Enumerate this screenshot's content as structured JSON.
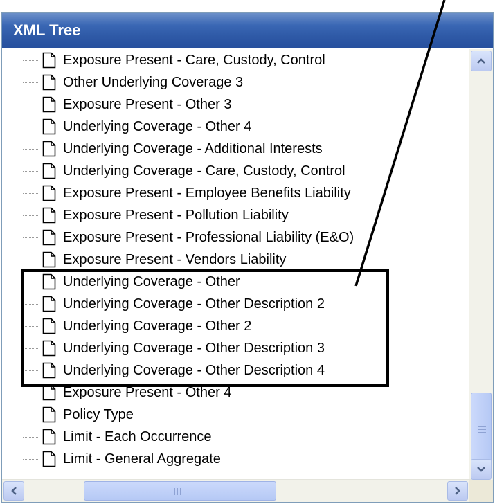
{
  "window": {
    "title": "XML Tree"
  },
  "tree": {
    "items": [
      "Exposure Present -  Care, Custody, Control",
      "Other Underlying Coverage 3",
      "Exposure Present - Other 3",
      "Underlying Coverage - Other 4",
      "Underlying Coverage - Additional Interests",
      "Underlying Coverage - Care, Custody, Control",
      "Exposure Present -  Employee Benefits Liability",
      "Exposure Present - Pollution Liability",
      "Exposure Present - Professional Liability (E&O)",
      "Exposure Present - Vendors Liability",
      "Underlying Coverage - Other",
      "Underlying Coverage - Other Description 2",
      "Underlying Coverage - Other 2",
      "Underlying Coverage - Other Description 3",
      "Underlying Coverage - Other Description 4",
      "Exposure Present - Other 4",
      "Policy Type",
      "Limit - Each Occurrence",
      "Limit - General Aggregate"
    ],
    "item_icon": "document-icon"
  },
  "scrollbars": {
    "vertical_position": 0.82,
    "horizontal_position": 0.08
  },
  "colors": {
    "titlebar": "#2f5aa7",
    "annotation": "#000000"
  }
}
